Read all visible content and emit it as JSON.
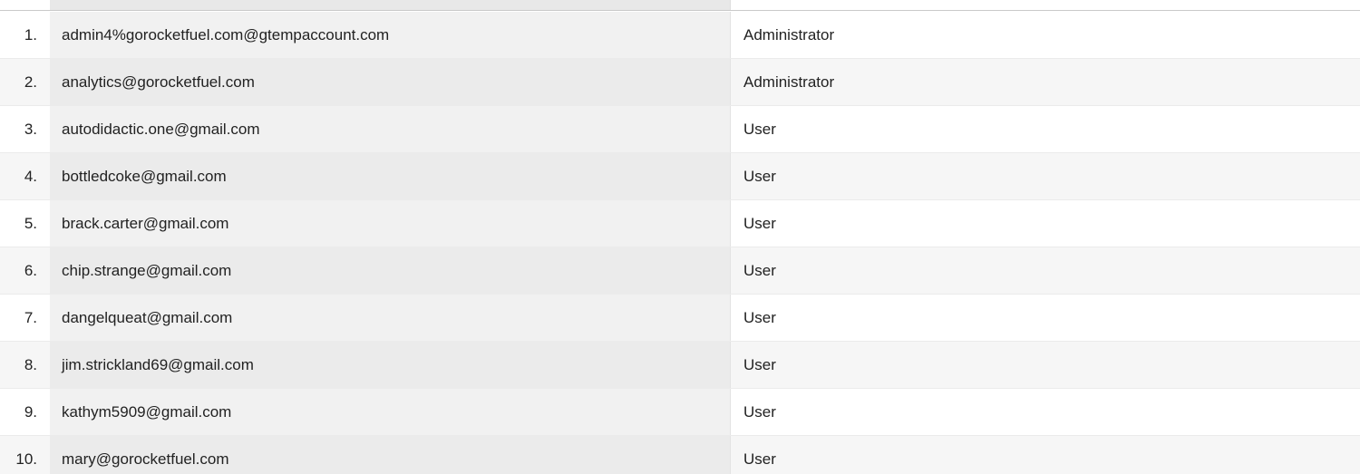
{
  "users_table": {
    "rows": [
      {
        "index": "1.",
        "email": "admin4%gorocketfuel.com@gtempaccount.com",
        "role": "Administrator"
      },
      {
        "index": "2.",
        "email": "analytics@gorocketfuel.com",
        "role": "Administrator"
      },
      {
        "index": "3.",
        "email": "autodidactic.one@gmail.com",
        "role": "User"
      },
      {
        "index": "4.",
        "email": "bottledcoke@gmail.com",
        "role": "User"
      },
      {
        "index": "5.",
        "email": "brack.carter@gmail.com",
        "role": "User"
      },
      {
        "index": "6.",
        "email": "chip.strange@gmail.com",
        "role": "User"
      },
      {
        "index": "7.",
        "email": "dangelqueat@gmail.com",
        "role": "User"
      },
      {
        "index": "8.",
        "email": "jim.strickland69@gmail.com",
        "role": "User"
      },
      {
        "index": "9.",
        "email": "kathym5909@gmail.com",
        "role": "User"
      },
      {
        "index": "10.",
        "email": "mary@gorocketfuel.com",
        "role": "User"
      }
    ]
  }
}
